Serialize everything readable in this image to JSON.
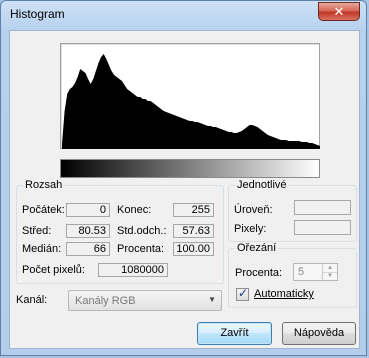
{
  "window": {
    "title": "Histogram",
    "close_glyph": "✕"
  },
  "histogram": {
    "bins": [
      0.05,
      0.38,
      0.55,
      0.6,
      0.62,
      0.66,
      0.72,
      0.8,
      0.78,
      0.76,
      0.7,
      0.65,
      0.7,
      0.78,
      0.86,
      0.92,
      0.95,
      0.9,
      0.84,
      0.78,
      0.74,
      0.72,
      0.7,
      0.68,
      0.64,
      0.6,
      0.58,
      0.56,
      0.54,
      0.52,
      0.52,
      0.5,
      0.5,
      0.48,
      0.48,
      0.46,
      0.44,
      0.42,
      0.4,
      0.38,
      0.37,
      0.36,
      0.35,
      0.34,
      0.33,
      0.32,
      0.31,
      0.3,
      0.29,
      0.28,
      0.28,
      0.27,
      0.27,
      0.26,
      0.25,
      0.24,
      0.23,
      0.23,
      0.22,
      0.22,
      0.21,
      0.2,
      0.19,
      0.18,
      0.17,
      0.17,
      0.16,
      0.16,
      0.17,
      0.18,
      0.2,
      0.22,
      0.24,
      0.24,
      0.23,
      0.22,
      0.2,
      0.18,
      0.16,
      0.14,
      0.13,
      0.12,
      0.11,
      0.1,
      0.09,
      0.09,
      0.09,
      0.08,
      0.08,
      0.08,
      0.08,
      0.08,
      0.07,
      0.07,
      0.07,
      0.06,
      0.06,
      0.05,
      0.04,
      0.03
    ]
  },
  "range": {
    "legend": "Rozsah",
    "start_label": "Počátek:",
    "start_value": "0",
    "end_label": "Konec:",
    "end_value": "255",
    "mean_label": "Střed:",
    "mean_value": "80.53",
    "std_label": "Std.odch.:",
    "std_value": "57.63",
    "median_label": "Medián:",
    "median_value": "66",
    "percent_label": "Procenta:",
    "percent_value": "100.00",
    "pixels_label": "Počet pixelů:",
    "pixels_value": "1080000"
  },
  "single": {
    "legend": "Jednotlivé",
    "level_label": "Úroveň:",
    "level_value": "",
    "pixels_label": "Pixely:",
    "pixels_value": ""
  },
  "clip": {
    "legend": "Ořezání",
    "percent_label": "Procenta:",
    "percent_value": "5",
    "auto_label": "Automaticky",
    "auto_checked": true
  },
  "channel": {
    "label": "Kanál:",
    "selected": "Kanály RGB"
  },
  "buttons": {
    "close": "Zavřít",
    "help": "Nápověda"
  }
}
